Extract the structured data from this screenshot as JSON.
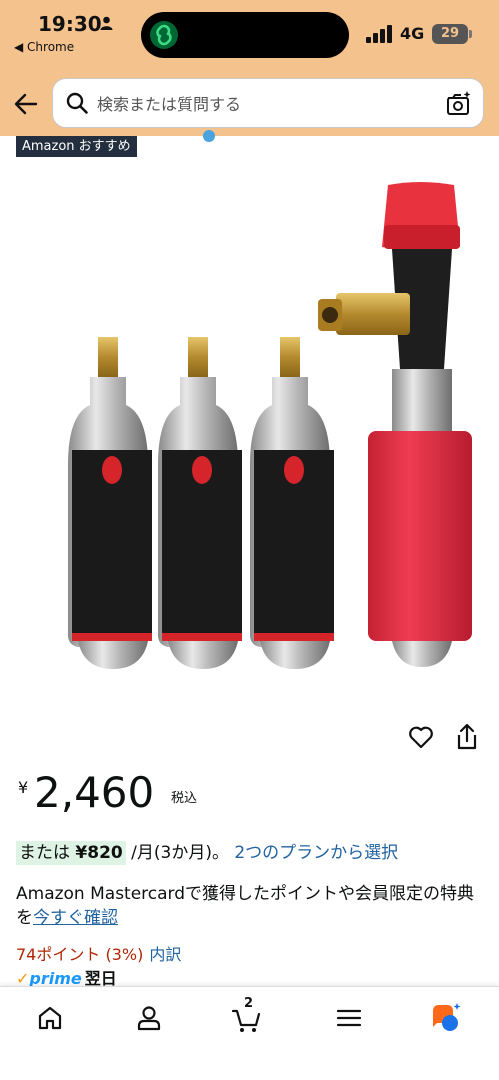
{
  "status_bar": {
    "time": "19:30",
    "back_app": "◀ Chrome",
    "network": "4G",
    "battery": "29"
  },
  "search": {
    "placeholder": "検索または質問する"
  },
  "badge": "Amazon おすすめ",
  "product": {
    "image_alt": "CO2 cartridges and inflator",
    "currency": "¥",
    "price": "2,460",
    "tax_label": "税込",
    "plan_prefix": "または",
    "plan_amount": "¥820",
    "plan_term": "/月(3か月)。",
    "plan_link": "2つのプランから選択",
    "mc_text": "Amazon Mastercardで獲得したポイントや会員限定の特典を",
    "mc_link": "今すぐ確認",
    "points": "74ポイント (3%)",
    "points_link": "内訳",
    "prime_label": "prime",
    "delivery": "翌日"
  },
  "bottom_nav": {
    "cart_count": "2",
    "items": [
      "home-icon",
      "account-icon",
      "cart-icon",
      "menu-icon",
      "rufus-icon"
    ]
  },
  "colors": {
    "header_bg": "#f3c28d",
    "link": "#2162a1",
    "points": "#b12704",
    "prime": "#1a98ff"
  }
}
